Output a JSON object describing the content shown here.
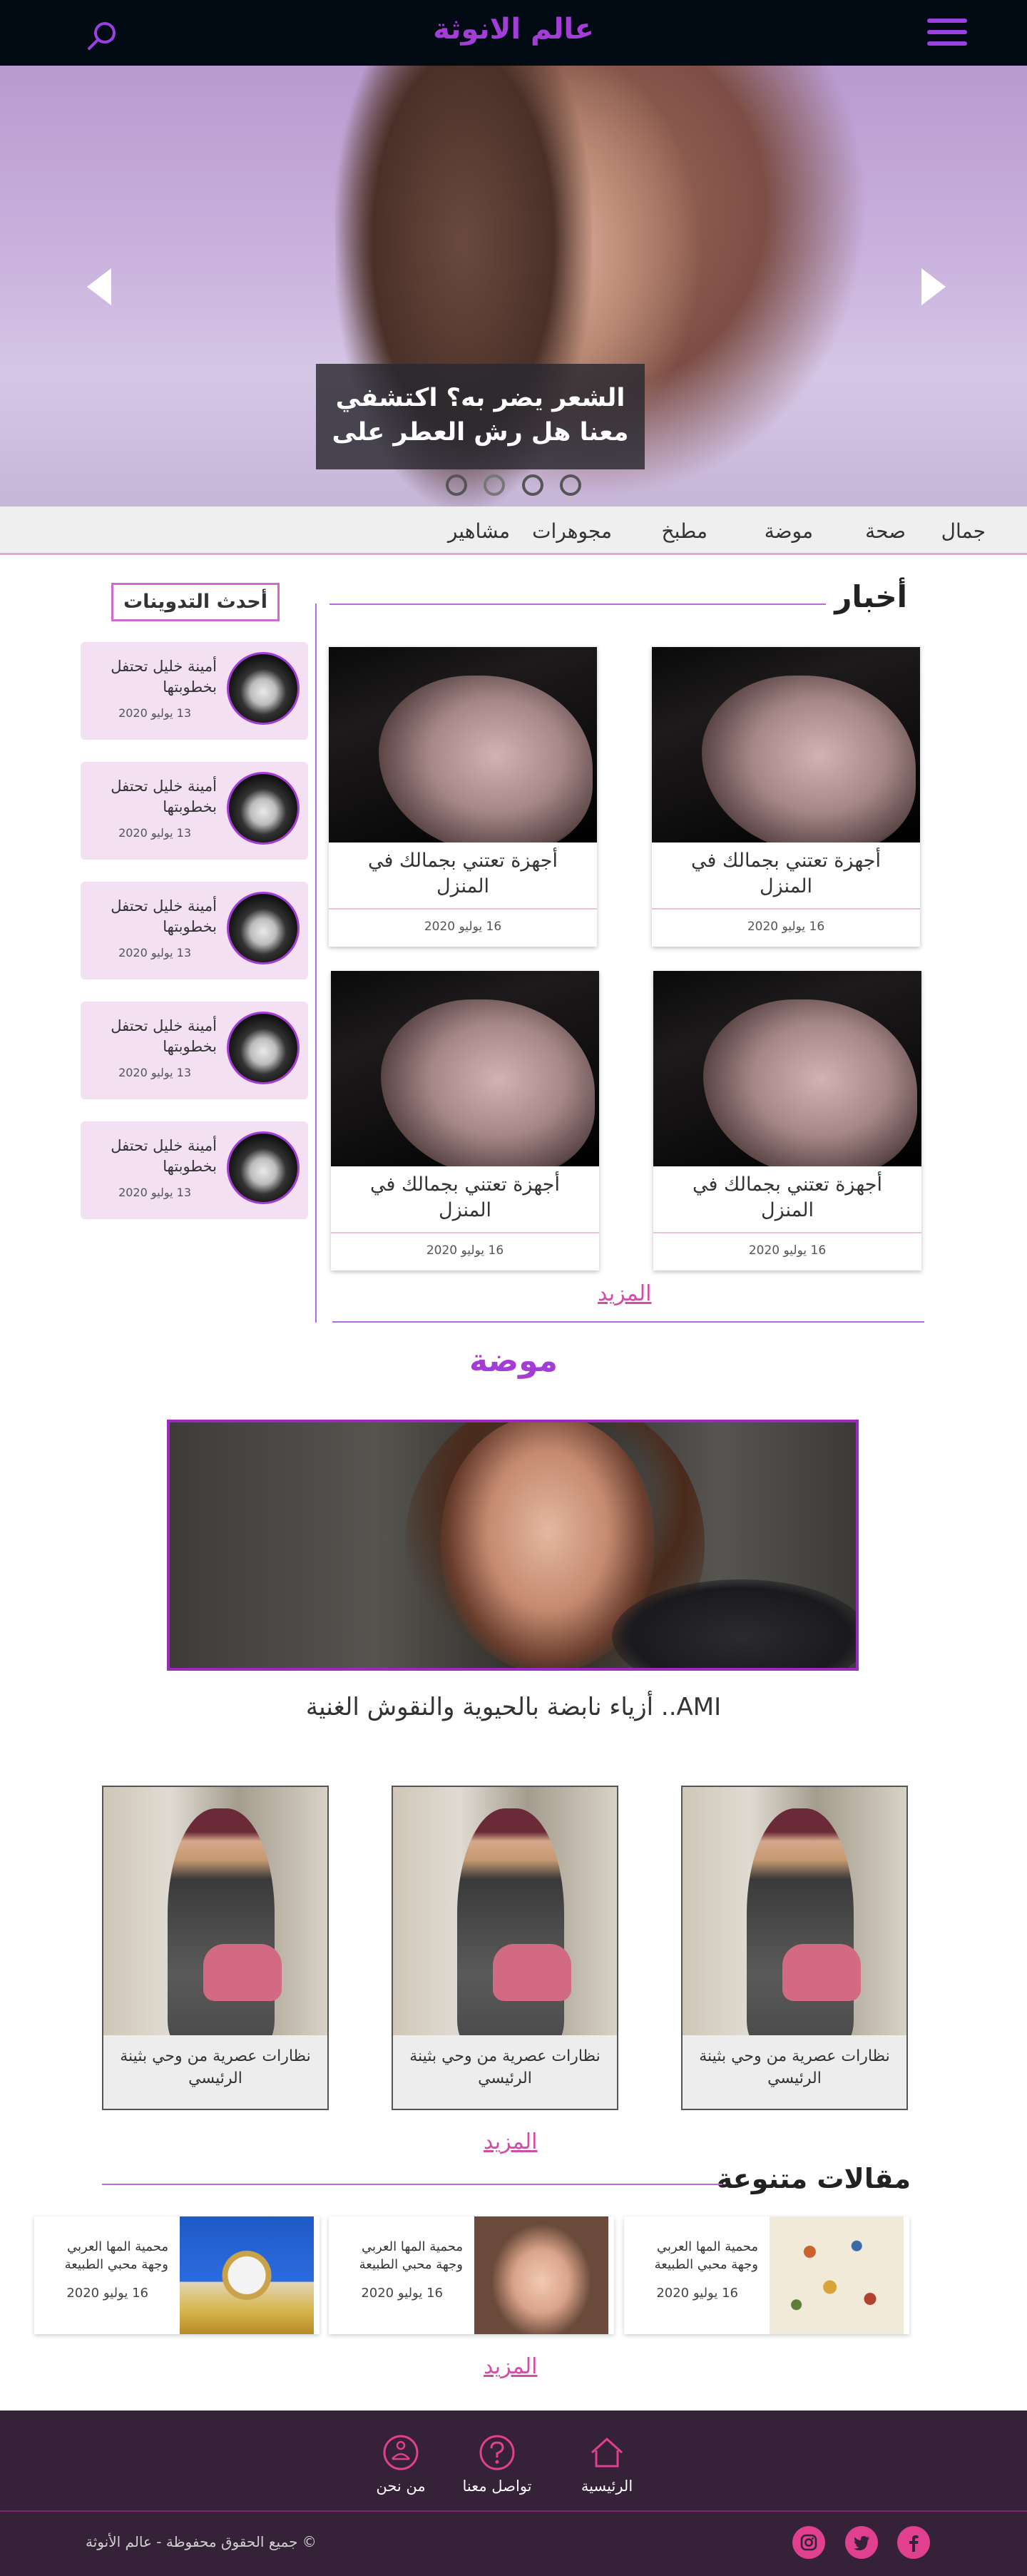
{
  "header": {
    "brand": "عالم الانوثة",
    "menu_icon": "hamburger-menu-icon",
    "search_icon": "search-icon",
    "accent": "#a43dd6"
  },
  "hero": {
    "caption": "الشعر يضر به؟ اكتشفي معنا هل رش العطر على",
    "prev_icon": "chevron-left-icon",
    "next_icon": "chevron-right-icon",
    "slides": 4,
    "active_slide": 3
  },
  "nav": {
    "items": [
      "جمال",
      "صحة",
      "موضة",
      "مطبخ",
      "مجوهرات",
      "مشاهير"
    ]
  },
  "news": {
    "title": "أخبار",
    "cards": [
      {
        "title": "أجهزة تعتني بجمالك في المنزل",
        "date": "16 يوليو 2020"
      },
      {
        "title": "أجهزة تعتني بجمالك في المنزل",
        "date": "16 يوليو 2020"
      },
      {
        "title": "أجهزة تعتني بجمالك في المنزل",
        "date": "16 يوليو 2020"
      },
      {
        "title": "أجهزة تعتني بجمالك في المنزل",
        "date": "16 يوليو 2020"
      }
    ],
    "more": "المزيد"
  },
  "sidebar": {
    "title": "أحدث التدوينات",
    "items": [
      {
        "text": "أمينة خليل تحتفل بخطوبتها",
        "date": "13 يوليو 2020"
      },
      {
        "text": "أمينة خليل تحتفل بخطوبتها",
        "date": "13 يوليو 2020"
      },
      {
        "text": "أمينة خليل تحتفل بخطوبتها",
        "date": "13 يوليو 2020"
      },
      {
        "text": "أمينة خليل تحتفل بخطوبتها",
        "date": "13 يوليو 2020"
      },
      {
        "text": "أمينة خليل تحتفل بخطوبتها",
        "date": "13 يوليو 2020"
      }
    ]
  },
  "fashion": {
    "title": "موضة",
    "feature_caption": "AMI.. أزياء نابضة بالحيوية والنقوش الغنية",
    "cards": [
      {
        "title": "نظارات عصرية من وحي بثينة الرئيسي"
      },
      {
        "title": "نظارات عصرية من وحي بثينة الرئيسي"
      },
      {
        "title": "نظارات عصرية من وحي بثينة الرئيسي"
      }
    ],
    "more": "المزيد"
  },
  "misc": {
    "title": "مقالات متنوعة",
    "cards": [
      {
        "text": "محمية المها العربي وجهة محبي الطبيعة",
        "date": "16 يوليو 2020",
        "image": "birds-illustration"
      },
      {
        "text": "محمية المها العربي وجهة محبي الطبيعة",
        "date": "16 يوليو 2020",
        "image": "baby-photo"
      },
      {
        "text": "محمية المها العربي وجهة محبي الطبيعة",
        "date": "16 يوليو 2020",
        "image": "clock-building"
      }
    ],
    "more": "المزيد"
  },
  "footer": {
    "nav": [
      {
        "label": "الرئيسية",
        "icon": "home-icon"
      },
      {
        "label": "تواصل معنا",
        "icon": "question-icon"
      },
      {
        "label": "من نحن",
        "icon": "meditation-icon"
      }
    ],
    "copyright": "© جميع الحقوق محفوظة - عالم الأنوثة",
    "social": [
      "facebook-icon",
      "twitter-icon",
      "instagram-icon"
    ],
    "social_color": "#e0408f",
    "bg": "#352138"
  }
}
